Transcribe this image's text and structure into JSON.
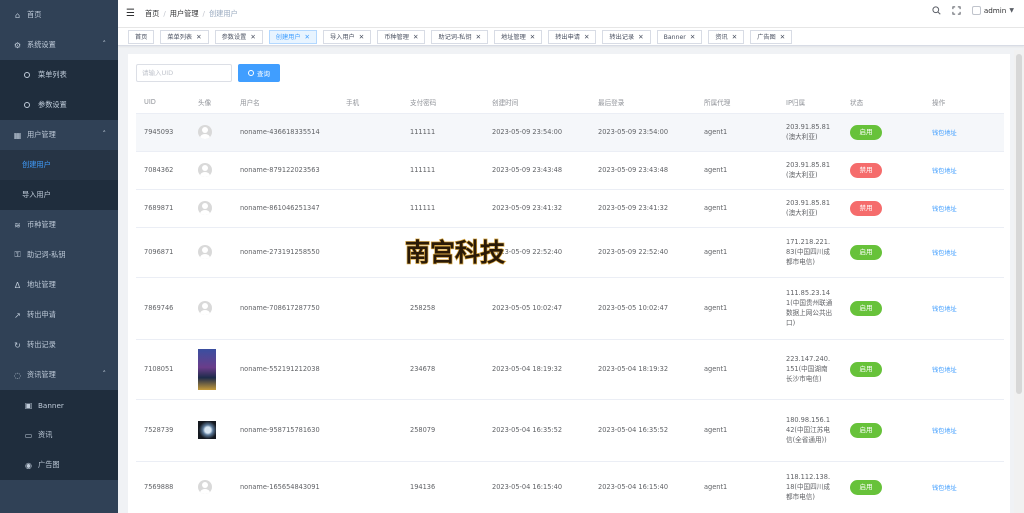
{
  "sidebar": {
    "items": [
      {
        "label": "首页",
        "icon": "home-icon",
        "kind": "top"
      },
      {
        "label": "系统设置",
        "icon": "gear-icon",
        "kind": "top",
        "expanded": true
      },
      {
        "label": "菜单列表",
        "icon": "circle-dot-icon",
        "kind": "sub"
      },
      {
        "label": "参数设置",
        "icon": "circle-dot-icon",
        "kind": "sub"
      },
      {
        "label": "用户管理",
        "icon": "users-icon",
        "kind": "top",
        "expanded": true
      },
      {
        "label": "创建用户",
        "icon": "",
        "kind": "sub",
        "active": true
      },
      {
        "label": "导入用户",
        "icon": "",
        "kind": "sub"
      },
      {
        "label": "币种管理",
        "icon": "coin-icon",
        "kind": "top"
      },
      {
        "label": "助记词-私钥",
        "icon": "key-icon",
        "kind": "top"
      },
      {
        "label": "地址管理",
        "icon": "person-icon",
        "kind": "top"
      },
      {
        "label": "转出申请",
        "icon": "send-icon",
        "kind": "top"
      },
      {
        "label": "转出记录",
        "icon": "record-icon",
        "kind": "top"
      },
      {
        "label": "资讯管理",
        "icon": "chat-icon",
        "kind": "top",
        "expanded": true
      },
      {
        "label": "Banner",
        "icon": "image-icon",
        "kind": "sub"
      },
      {
        "label": "资讯",
        "icon": "message-icon",
        "kind": "sub"
      },
      {
        "label": "广告图",
        "icon": "eye-icon",
        "kind": "sub"
      }
    ]
  },
  "header": {
    "breadcrumb": [
      "首页",
      "用户管理",
      "创建用户"
    ],
    "separator": "/",
    "user": "admin"
  },
  "tags": [
    {
      "label": "首页",
      "closable": false
    },
    {
      "label": "菜单列表",
      "closable": true
    },
    {
      "label": "参数设置",
      "closable": true
    },
    {
      "label": "创建用户",
      "closable": true,
      "active": true
    },
    {
      "label": "导入用户",
      "closable": true
    },
    {
      "label": "币种管理",
      "closable": true
    },
    {
      "label": "助记词-私钥",
      "closable": true
    },
    {
      "label": "地址管理",
      "closable": true
    },
    {
      "label": "转出申请",
      "closable": true
    },
    {
      "label": "转出记录",
      "closable": true
    },
    {
      "label": "Banner",
      "closable": true
    },
    {
      "label": "资讯",
      "closable": true
    },
    {
      "label": "广告图",
      "closable": true
    }
  ],
  "search": {
    "placeholder": "请输入UID",
    "value": "",
    "button_label": "查询"
  },
  "table": {
    "columns": [
      "UID",
      "头像",
      "用户名",
      "手机",
      "支付密码",
      "创建时间",
      "最后登录",
      "所属代理",
      "IP归属",
      "状态",
      "操作"
    ],
    "rows": [
      {
        "uid": "7945093",
        "avatar": "default",
        "username": "noname-436618335514",
        "phone": "",
        "pay_pwd": "111111",
        "created": "2023-05-09 23:54:00",
        "last_login": "2023-05-09 23:54:00",
        "agent": "agent1",
        "ip": "203.91.85.81(澳大利亚)",
        "status": "启用",
        "status_on": true,
        "action": "钱包地址"
      },
      {
        "uid": "7084362",
        "avatar": "default",
        "username": "noname-879122023563",
        "phone": "",
        "pay_pwd": "111111",
        "created": "2023-05-09 23:43:48",
        "last_login": "2023-05-09 23:43:48",
        "agent": "agent1",
        "ip": "203.91.85.81(澳大利亚)",
        "status": "禁用",
        "status_on": false,
        "action": "钱包地址"
      },
      {
        "uid": "7689871",
        "avatar": "default",
        "username": "noname-861046251347",
        "phone": "",
        "pay_pwd": "111111",
        "created": "2023-05-09 23:41:32",
        "last_login": "2023-05-09 23:41:32",
        "agent": "agent1",
        "ip": "203.91.85.81(澳大利亚)",
        "status": "禁用",
        "status_on": false,
        "action": "钱包地址"
      },
      {
        "uid": "7096871",
        "avatar": "default",
        "username": "noname-273191258550",
        "phone": "",
        "pay_pwd": "",
        "created": "2023-05-09 22:52:40",
        "last_login": "2023-05-09 22:52:40",
        "agent": "agent1",
        "ip": "171.218.221.83(中国四川成都市电信)",
        "status": "启用",
        "status_on": true,
        "action": "钱包地址"
      },
      {
        "uid": "7869746",
        "avatar": "default",
        "username": "noname-708617287750",
        "phone": "",
        "pay_pwd": "258258",
        "created": "2023-05-05 10:02:47",
        "last_login": "2023-05-05 10:02:47",
        "agent": "agent1",
        "ip": "111.85.23.141(中国贵州联通数据上网公共出口)",
        "status": "启用",
        "status_on": true,
        "action": "钱包地址"
      },
      {
        "uid": "7108051",
        "avatar": "photo-tall",
        "username": "noname-552191212038",
        "phone": "",
        "pay_pwd": "234678",
        "created": "2023-05-04 18:19:32",
        "last_login": "2023-05-04 18:19:32",
        "agent": "agent1",
        "ip": "223.147.240.151(中国湖南长沙市电信)",
        "status": "启用",
        "status_on": true,
        "action": "钱包地址"
      },
      {
        "uid": "7528739",
        "avatar": "photo-sq",
        "username": "noname-958715781630",
        "phone": "",
        "pay_pwd": "258079",
        "created": "2023-05-04 16:35:52",
        "last_login": "2023-05-04 16:35:52",
        "agent": "agent1",
        "ip": "180.98.156.142(中国江苏电信(全省通用))",
        "status": "启用",
        "status_on": true,
        "action": "钱包地址"
      },
      {
        "uid": "7569888",
        "avatar": "default",
        "username": "noname-165654843091",
        "phone": "",
        "pay_pwd": "194136",
        "created": "2023-05-04 16:15:40",
        "last_login": "2023-05-04 16:15:40",
        "agent": "agent1",
        "ip": "118.112.138.18(中国四川成都市电信)",
        "status": "启用",
        "status_on": true,
        "action": "钱包地址"
      }
    ]
  },
  "watermark": {
    "text": "南宫科技"
  },
  "colors": {
    "sidebar_bg": "#304156",
    "primary": "#409eff",
    "success": "#67c23a",
    "danger": "#f56c6c"
  }
}
